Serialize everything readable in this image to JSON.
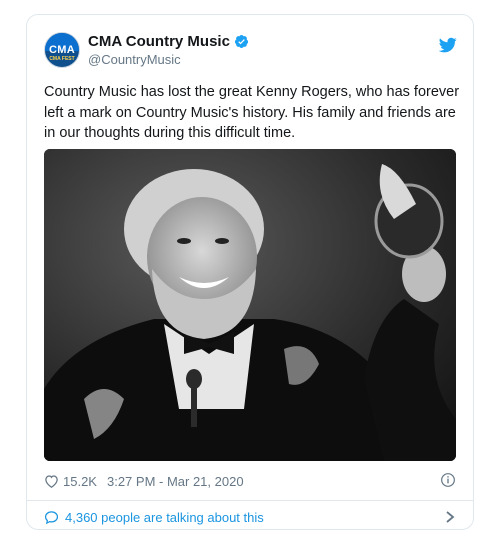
{
  "account": {
    "display_name": "CMA Country Music",
    "handle": "@CountryMusic",
    "avatar_text": "CMA",
    "avatar_subtext": "CMA FEST"
  },
  "tweet": {
    "text": "Country Music has lost the great Kenny Rogers, who has forever left a mark on Country Music's history. His family and friends are in our thoughts during this difficult time."
  },
  "meta": {
    "likes": "15.2K",
    "timestamp": "3:27 PM - Mar 21, 2020"
  },
  "conversation": {
    "label": "4,360 people are talking about this"
  },
  "colors": {
    "accent": "#1da1f2",
    "link": "#1b95e0",
    "muted": "#657786",
    "border": "#e1e8ed"
  },
  "icons": {
    "verified": "verified-badge-icon",
    "brand": "twitter-bird-icon",
    "like": "heart-icon",
    "info": "info-icon",
    "reply": "speech-bubble-icon",
    "chevron": "chevron-right-icon"
  }
}
